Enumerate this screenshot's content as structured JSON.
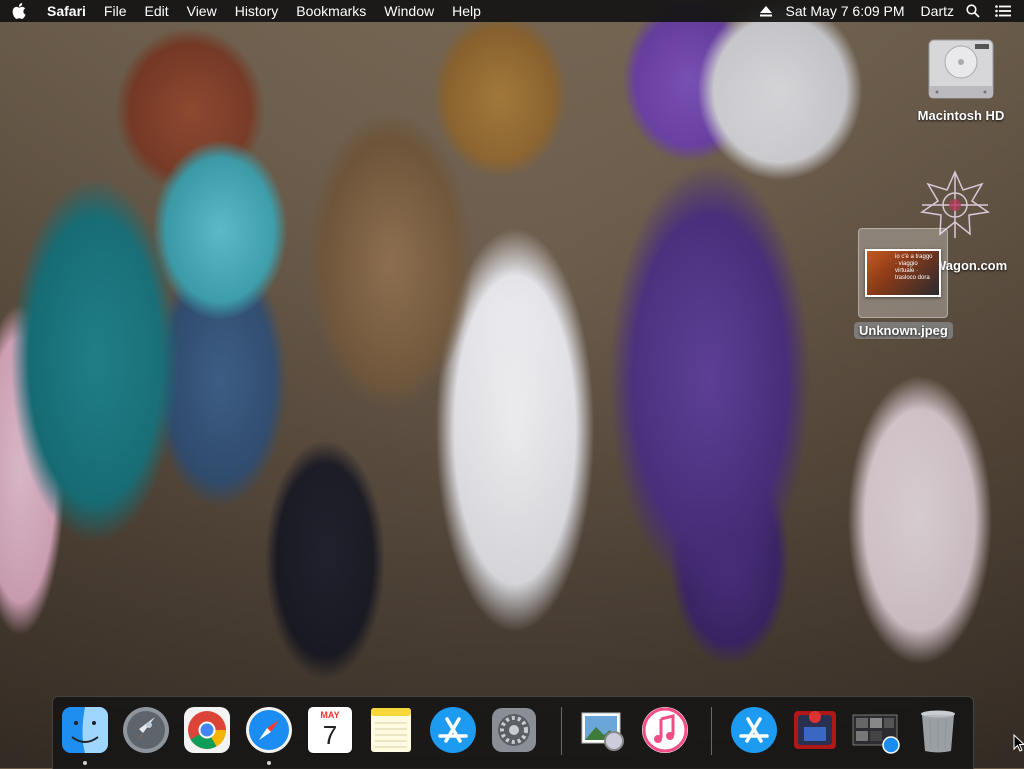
{
  "menubar": {
    "apple_icon": "apple-icon",
    "app_name": "Safari",
    "menus": [
      "File",
      "Edit",
      "View",
      "History",
      "Bookmarks",
      "Window",
      "Help"
    ],
    "eject_icon": "eject-icon",
    "datetime": "Sat May 7  6:09 PM",
    "user": "Dartz",
    "search_icon": "spotlight-search-icon",
    "notifications_icon": "notification-center-icon"
  },
  "desktop": {
    "icons": [
      {
        "label": "Macintosh HD",
        "icon": "hard-drive-icon"
      },
      {
        "label": "Unknown.jpeg",
        "icon": "image-file-icon",
        "thumbnail_caption": "io c'è a traggo · viaggio virtuale · trasloco dora"
      },
      {
        "label": "Wagon.com",
        "icon": "web-shortcut-icon"
      }
    ]
  },
  "dock": {
    "items": [
      {
        "name": "Finder",
        "icon": "finder-icon",
        "running": true
      },
      {
        "name": "Launchpad",
        "icon": "launchpad-icon",
        "running": false
      },
      {
        "name": "Google Chrome",
        "icon": "chrome-icon",
        "running": false
      },
      {
        "name": "Safari",
        "icon": "safari-icon",
        "running": true
      },
      {
        "name": "Calendar",
        "icon": "calendar-icon",
        "running": false,
        "month": "MAY",
        "day": "7"
      },
      {
        "name": "Notes",
        "icon": "notes-icon",
        "running": false
      },
      {
        "name": "App Store",
        "icon": "app-store-icon",
        "running": false
      },
      {
        "name": "System Preferences",
        "icon": "system-preferences-icon",
        "running": false
      },
      {
        "name": "Preview",
        "icon": "preview-icon",
        "running": false
      },
      {
        "name": "iTunes",
        "icon": "itunes-icon",
        "running": false
      },
      {
        "name": "App Store Downloads",
        "icon": "app-store-folder-icon",
        "running": false
      },
      {
        "name": "Photo Booth",
        "icon": "photo-booth-icon",
        "running": false
      },
      {
        "name": "Screenshots",
        "icon": "screenshots-folder-icon",
        "running": false
      },
      {
        "name": "Trash",
        "icon": "trash-icon",
        "running": false
      }
    ]
  },
  "colors": {
    "menubar_bg": "#141414",
    "dock_bg": "#141414",
    "label_text": "#ffffff"
  }
}
